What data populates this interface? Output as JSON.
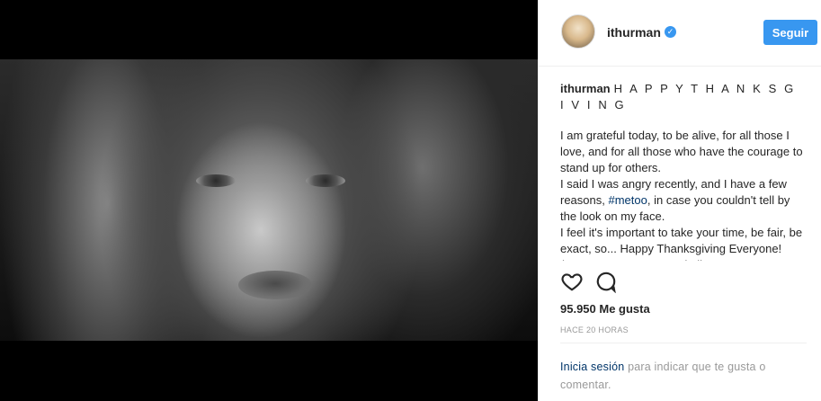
{
  "post": {
    "media_alt": "",
    "username": "ithurman",
    "verified_icon": "verified-badge-icon",
    "follow_label": "Seguir",
    "caption_user": "ithurman",
    "caption_title": "H A P P Y T H A N K S G I V I N G",
    "caption_lines": [
      "I am grateful today, to be alive, for all those I love, and for all those who have the courage to stand up for others.",
      "I said I was angry recently, and I have a few reasons, ",
      "#metoo",
      ", in case you couldn't tell by the look on my face.",
      "I feel it's important to take your time, be fair, be exact, so... Happy Thanksgiving Everyone! (Except you Harvey, and all your"
    ],
    "likes": "95.950 Me gusta",
    "timestamp": "HACE 20 HORAS",
    "login_link": "Inicia sesión",
    "login_rest": " para indicar que te gusta o comentar."
  },
  "colors": {
    "accent": "#3897f0",
    "link": "#003569",
    "muted": "#999999",
    "text": "#262626"
  }
}
